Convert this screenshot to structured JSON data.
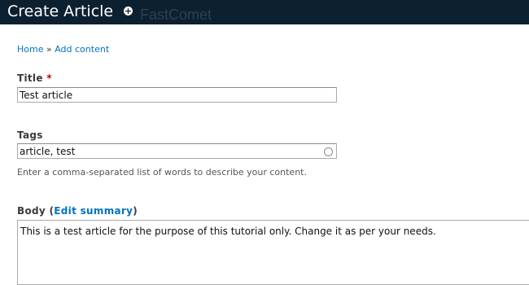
{
  "header": {
    "title": "Create Article",
    "watermark": "FastComet"
  },
  "breadcrumb": {
    "home": "Home",
    "separator": "»",
    "add_content": "Add content"
  },
  "title_field": {
    "label": "Title",
    "required_mark": "*",
    "value": "Test article"
  },
  "tags_field": {
    "label": "Tags",
    "value": "article, test",
    "description": "Enter a comma-separated list of words to describe your content."
  },
  "body_field": {
    "label": "Body",
    "paren_open": "(",
    "edit_summary": "Edit summary",
    "paren_close": ")",
    "value": "This is a test article for the purpose of this tutorial only. Change it as per your needs."
  },
  "colors": {
    "header_bg": "#0d2030",
    "link": "#0074bd",
    "required": "#c00000"
  }
}
